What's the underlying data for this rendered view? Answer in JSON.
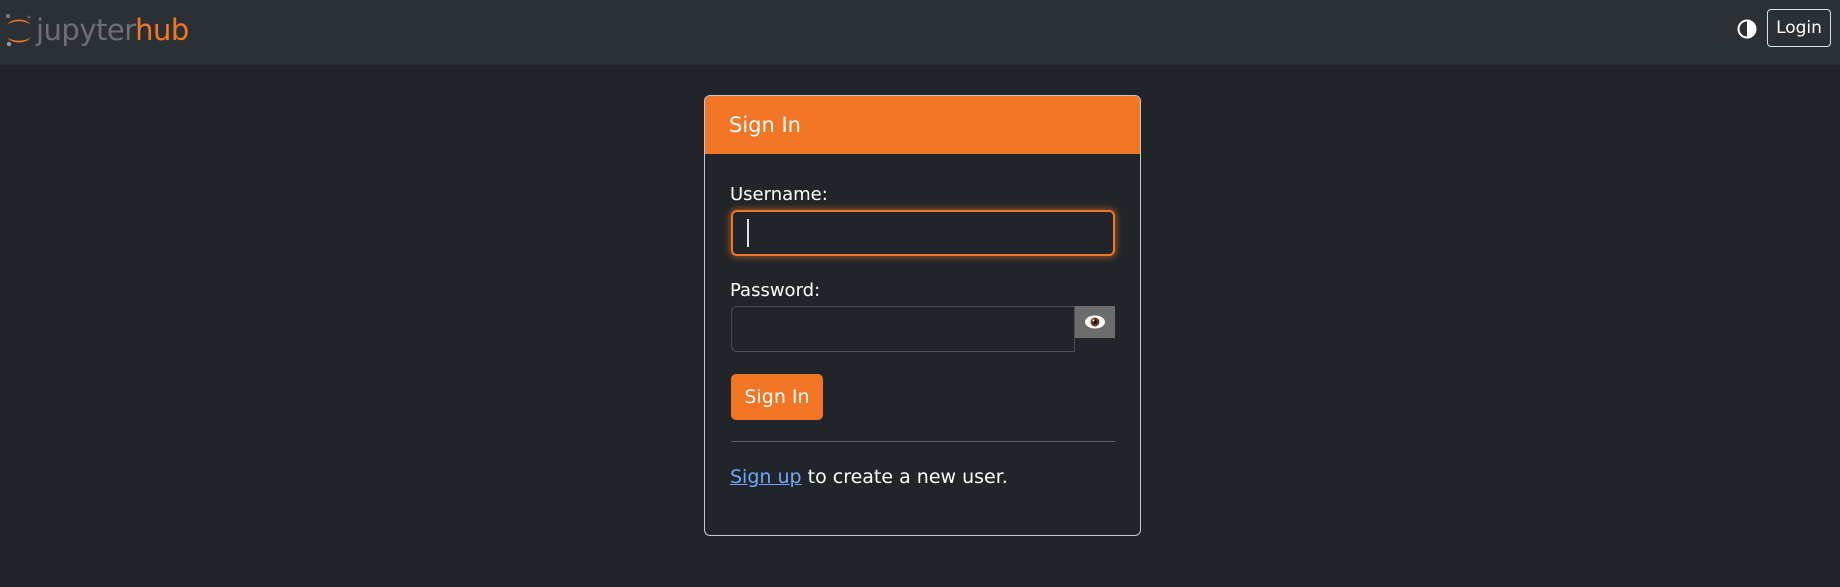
{
  "navbar": {
    "logo": {
      "text_primary": "jupyter",
      "text_accent": "hub",
      "primary_color": "#6c6f73",
      "accent_color": "#f37626"
    },
    "theme_toggle": {
      "icon": "contrast-icon"
    },
    "login_label": "Login"
  },
  "signin_card": {
    "title": "Sign In",
    "header_color": "#f37626",
    "username_label": "Username:",
    "username_value": "",
    "password_label": "Password:",
    "password_value": "",
    "show_password_icon": "eye-icon",
    "submit_label": "Sign In",
    "signup": {
      "link_text": "Sign up",
      "rest_text": " to create a new user."
    }
  },
  "colors": {
    "background": "#212529",
    "navbar": "#2b3035",
    "accent": "#f37626",
    "link": "#6ea8fe"
  }
}
